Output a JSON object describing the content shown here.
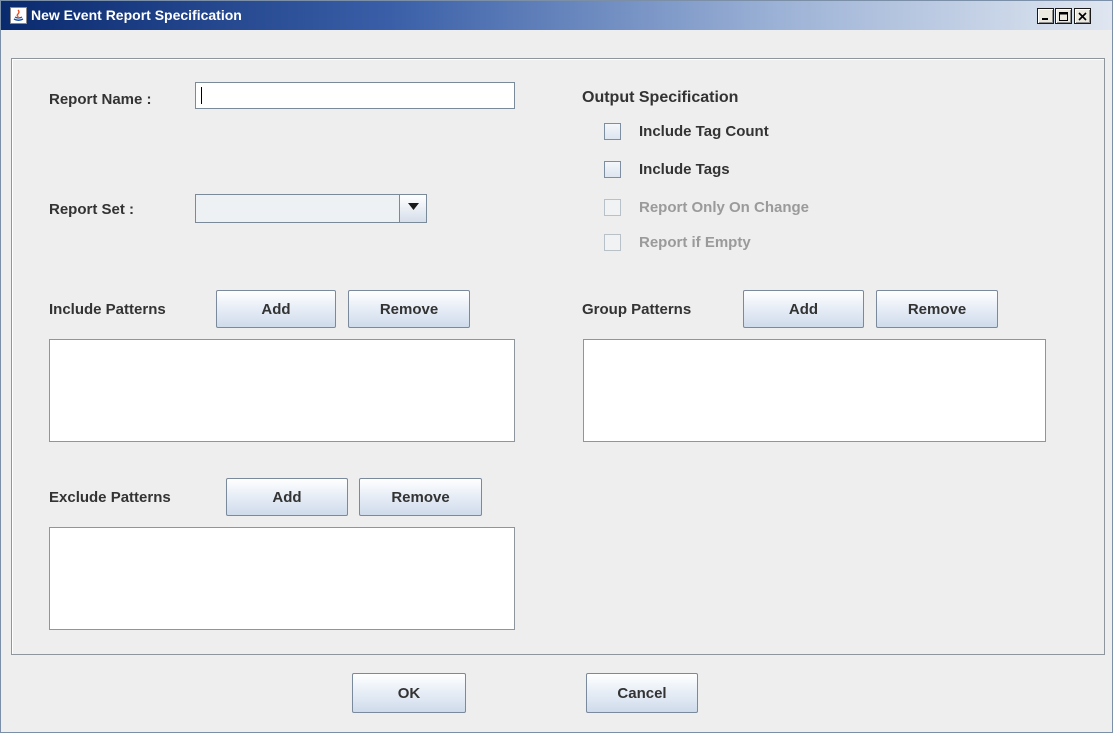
{
  "window": {
    "title": "New Event Report Specification",
    "controls": {
      "minimize": "_",
      "maximize": "□",
      "close": "×"
    }
  },
  "form": {
    "report_name_label": "Report Name :",
    "report_name_value": "",
    "report_set_label": "Report Set :",
    "report_set_value": ""
  },
  "output": {
    "heading": "Output Specification",
    "options": [
      {
        "label": "Include Tag Count",
        "checked": false,
        "enabled": true
      },
      {
        "label": "Include Tags",
        "checked": false,
        "enabled": true
      },
      {
        "label": "Report Only On Change",
        "checked": false,
        "enabled": false
      },
      {
        "label": "Report if Empty",
        "checked": false,
        "enabled": false
      }
    ]
  },
  "include_patterns": {
    "label": "Include Patterns",
    "add": "Add",
    "remove": "Remove"
  },
  "group_patterns": {
    "label": "Group Patterns",
    "add": "Add",
    "remove": "Remove"
  },
  "exclude_patterns": {
    "label": "Exclude Patterns",
    "add": "Add",
    "remove": "Remove"
  },
  "footer": {
    "ok": "OK",
    "cancel": "Cancel"
  }
}
